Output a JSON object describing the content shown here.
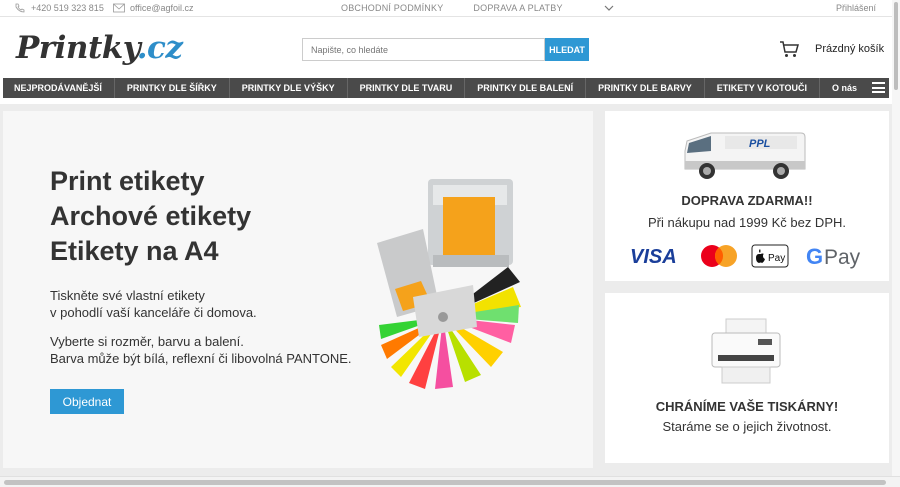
{
  "topbar": {
    "phone": "+420 519 323 815",
    "email": "office@agfoil.cz",
    "links": [
      "OBCHODNÍ PODMÍNKY",
      "DOPRAVA A PLATBY"
    ],
    "login": "Přihlášení"
  },
  "header": {
    "logo_main": "Printky",
    "logo_tld": ".cz",
    "search_placeholder": "Napište, co hledáte",
    "search_button": "HLEDAT",
    "cart_label": "Prázdný košík"
  },
  "nav": {
    "items": [
      "NEJPRODÁVANĚJŠÍ",
      "PRINTKY DLE ŠÍŘKY",
      "PRINTKY DLE VÝŠKY",
      "PRINTKY DLE TVARU",
      "PRINTKY DLE BALENÍ",
      "PRINTKY DLE BARVY",
      "ETIKETY V KOTOUČI",
      "O nás"
    ]
  },
  "hero": {
    "title_lines": [
      "Print etikety",
      "Archové etikety",
      "Etikety na A4"
    ],
    "paragraph1": [
      "Tiskněte své vlastní etikety",
      "v pohodlí vaší kanceláře či domova."
    ],
    "paragraph2": [
      "Vyberte si rozměr, barvu  a balení.",
      "Barva může být bílá, reflexní či libovolná PANTONE."
    ],
    "order_button": "Objednat"
  },
  "shipping_card": {
    "van_text": "PPL",
    "title": "DOPRAVA ZDARMA!!",
    "text": "Při nákupu nad 1999 Kč bez DPH.",
    "payment_icons": [
      "visa-icon",
      "mastercard-icon",
      "apple-pay-icon",
      "google-pay-icon"
    ],
    "payment_labels": {
      "visa": "VISA",
      "apple": "Pay",
      "google": "Pay"
    }
  },
  "printer_card": {
    "title": "CHRÁNÍME VAŠE TISKÁRNY!",
    "text": "Staráme se o jejich životnost."
  },
  "colors": {
    "accent": "#2e98d4",
    "nav_bg": "#4a4a4a",
    "logo_tld": "#2e8ec9",
    "page_bg": "#ececec"
  }
}
